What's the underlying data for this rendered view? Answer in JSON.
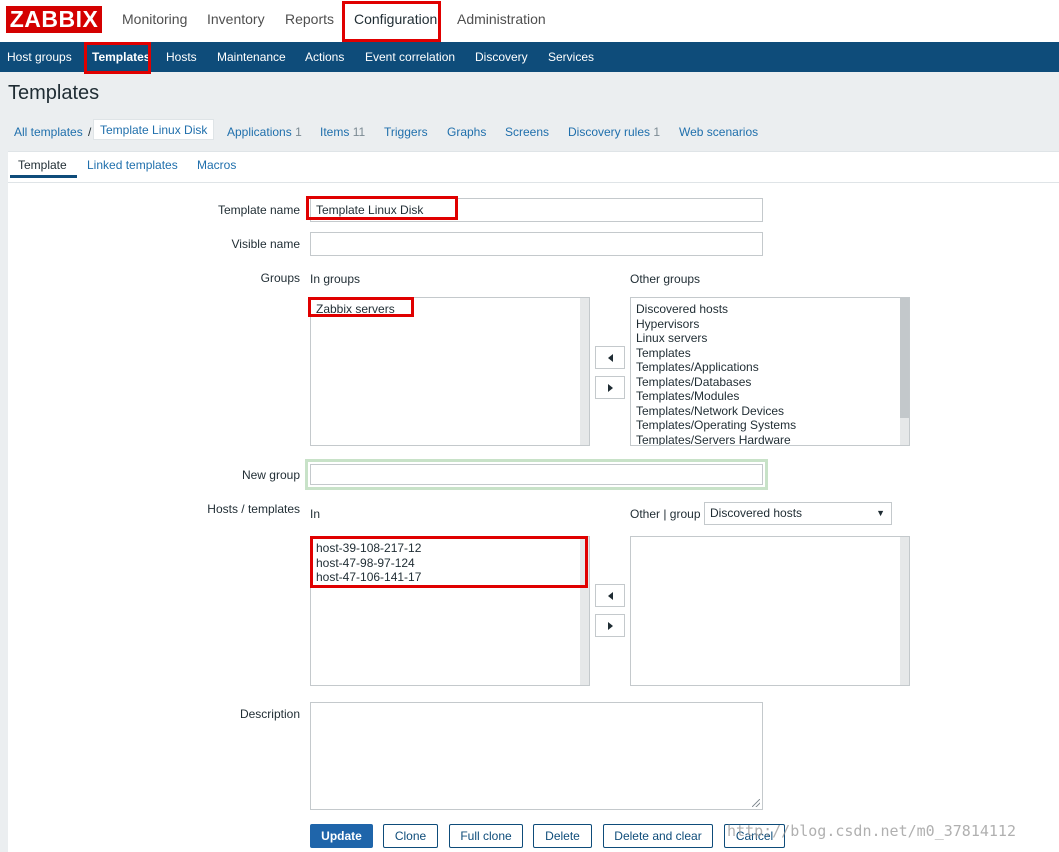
{
  "header": {
    "logo": "ZABBIX",
    "nav": [
      "Monitoring",
      "Inventory",
      "Reports",
      "Configuration",
      "Administration"
    ],
    "active_nav": "Configuration"
  },
  "subnav": {
    "items": [
      "Host groups",
      "Templates",
      "Hosts",
      "Maintenance",
      "Actions",
      "Event correlation",
      "Discovery",
      "Services"
    ],
    "active": "Templates"
  },
  "page_title": "Templates",
  "breadcrumb": {
    "all_templates": "All templates",
    "separator": "/",
    "current": "Template Linux Disk",
    "tabs": [
      {
        "label": "Applications",
        "count": "1"
      },
      {
        "label": "Items",
        "count": "11"
      },
      {
        "label": "Triggers",
        "count": ""
      },
      {
        "label": "Graphs",
        "count": ""
      },
      {
        "label": "Screens",
        "count": ""
      },
      {
        "label": "Discovery rules",
        "count": "1"
      },
      {
        "label": "Web scenarios",
        "count": ""
      }
    ]
  },
  "form_tabs": [
    "Template",
    "Linked templates",
    "Macros"
  ],
  "form": {
    "template_name_label": "Template name",
    "template_name_value": "Template Linux Disk",
    "visible_name_label": "Visible name",
    "visible_name_value": "",
    "groups_label": "Groups",
    "in_groups_label": "In groups",
    "in_groups": [
      "Zabbix servers"
    ],
    "other_groups_label": "Other groups",
    "other_groups": [
      "Discovered hosts",
      "Hypervisors",
      "Linux servers",
      "Templates",
      "Templates/Applications",
      "Templates/Databases",
      "Templates/Modules",
      "Templates/Network Devices",
      "Templates/Operating Systems",
      "Templates/Servers Hardware"
    ],
    "new_group_label": "New group",
    "new_group_value": "",
    "hosts_templates_label": "Hosts / templates",
    "in_label": "In",
    "in_hosts": [
      "host-39-108-217-12",
      "host-47-98-97-124",
      "host-47-106-141-17"
    ],
    "other_group_label": "Other | group",
    "other_group_selected": "Discovered hosts",
    "other_hosts": [],
    "description_label": "Description",
    "description_value": ""
  },
  "buttons": {
    "update": "Update",
    "clone": "Clone",
    "full_clone": "Full clone",
    "delete": "Delete",
    "delete_and_clear": "Delete and clear",
    "cancel": "Cancel"
  },
  "watermark": "http://blog.csdn.net/m0_37814112",
  "colors": {
    "logo_red": "#d40000",
    "subnav_bg": "#0e4c7a",
    "link_blue": "#1f6fac",
    "primary_button": "#1f65aa",
    "annotation_red": "#e00000"
  }
}
